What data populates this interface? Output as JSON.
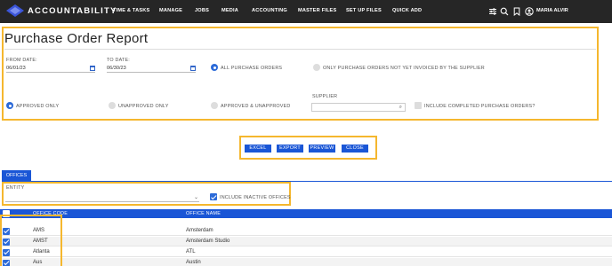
{
  "app": {
    "name": "ACCOUNTABILITY"
  },
  "nav": {
    "items": [
      "TIME & TASKS",
      "MANAGE",
      "JOBS",
      "MEDIA",
      "ACCOUNTING",
      "MASTER FILES",
      "SET UP FILES",
      "QUICK ADD"
    ],
    "icons": [
      "sliders-icon",
      "search-icon",
      "bookmark-icon",
      "user-circle-icon"
    ],
    "user_name": "MARIA ALVIR"
  },
  "report": {
    "title": "Purchase Order Report",
    "from_date_label": "FROM DATE:",
    "from_date_value": "06/01/23",
    "to_date_label": "TO DATE:",
    "to_date_value": "06/30/23",
    "po_options": [
      "ALL PURCHASE ORDERS",
      "ONLY PURCHASE ORDERS NOT YET INVOICED BY THE SUPPLIER"
    ],
    "po_selected": "ALL PURCHASE ORDERS",
    "approval_options": [
      "APPROVED ONLY",
      "UNAPPROVED ONLY",
      "APPROVED & UNAPPROVED"
    ],
    "approval_selected": "APPROVED ONLY",
    "supplier_label": "SUPPLIER",
    "supplier_value": "",
    "include_completed_label": "INCLUDE COMPLETED PURCHASE ORDERS?",
    "include_completed_checked": false
  },
  "actions": [
    "EXCEL",
    "EXPORT",
    "PREVIEW",
    "CLOSE"
  ],
  "offices": {
    "tab_label": "OFFICES",
    "entity_label": "ENTITY",
    "entity_value": "",
    "include_inactive_label": "INCLUDE INACTIVE OFFICES",
    "include_inactive_checked": true,
    "columns": [
      "OFFICE CODE",
      "OFFICE NAME"
    ],
    "rows": [
      {
        "code": "AMS",
        "name": "Amsterdam",
        "checked": true
      },
      {
        "code": "AMST",
        "name": "Amsterdam Studio",
        "checked": true
      },
      {
        "code": "Atlanta",
        "name": "ATL",
        "checked": true
      },
      {
        "code": "Aus",
        "name": "Austin",
        "checked": true
      }
    ]
  },
  "colors": {
    "accent": "#1a56d6",
    "highlight": "#f5b72e",
    "topbar": "#262626"
  }
}
